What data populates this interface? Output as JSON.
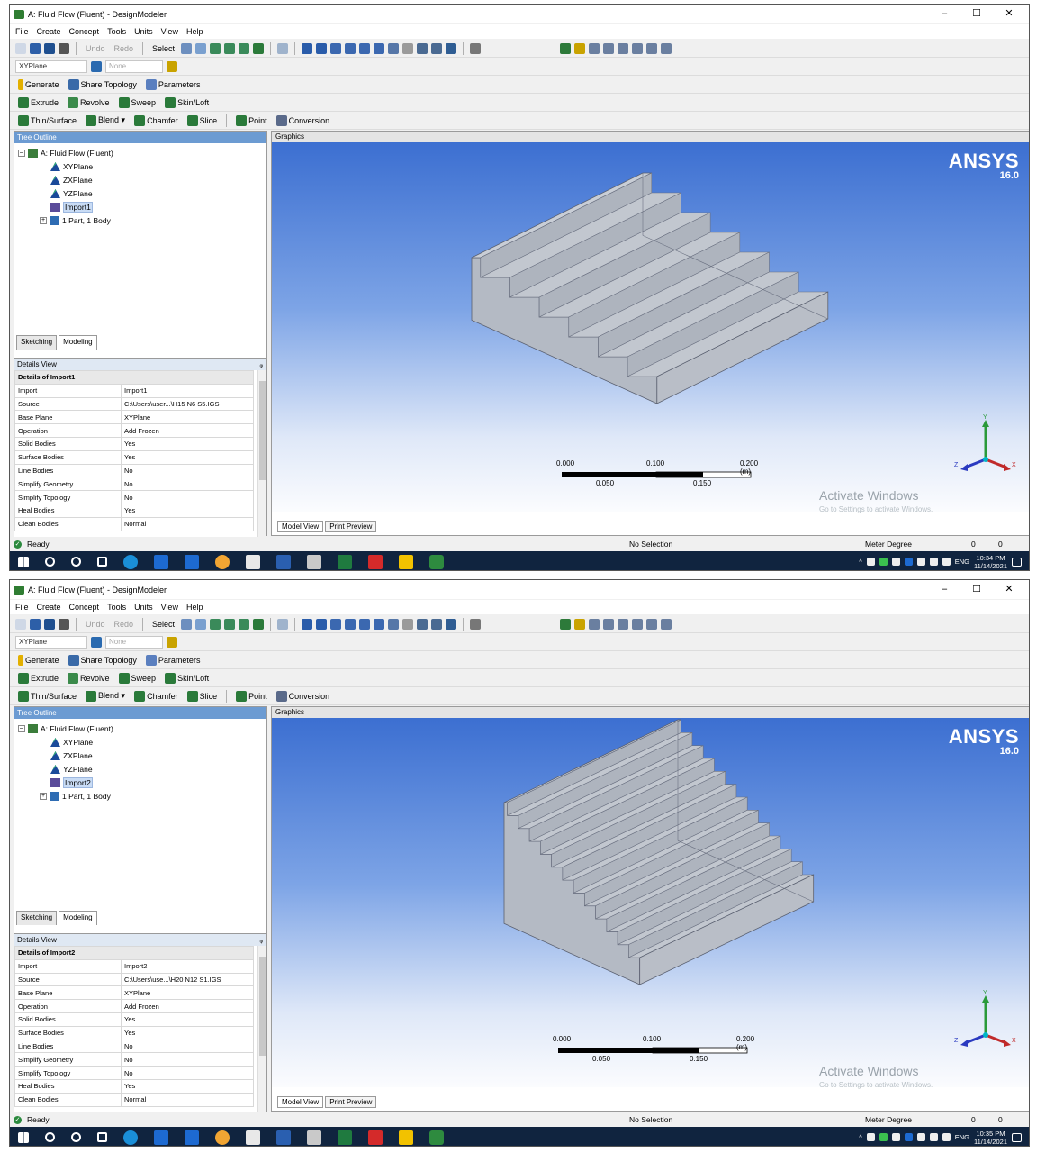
{
  "screens": [
    {
      "window_title": "A: Fluid Flow (Fluent) - DesignModeler",
      "window_controls": [
        "–",
        "☐",
        "✕"
      ],
      "menu": [
        "File",
        "Create",
        "Concept",
        "Tools",
        "Units",
        "View",
        "Help"
      ],
      "toolbar1": {
        "undo": "Undo",
        "redo": "Redo",
        "select": "Select"
      },
      "plane_combo": "XYPlane",
      "sketch_combo": "None",
      "toolbar3": [
        "Generate",
        "Share Topology",
        "Parameters"
      ],
      "toolbar4": [
        "Extrude",
        "Revolve",
        "Sweep",
        "Skin/Loft"
      ],
      "toolbar5": [
        "Thin/Surface",
        "Blend ▾",
        "Chamfer",
        "Slice",
        "Point",
        "Conversion"
      ],
      "tree_title": "Tree Outline",
      "tree": {
        "root": "A: Fluid Flow (Fluent)",
        "planes": [
          "XYPlane",
          "ZXPlane",
          "YZPlane"
        ],
        "import": "Import1",
        "body": "1 Part, 1 Body"
      },
      "tabs": [
        "Sketching",
        "Modeling"
      ],
      "details_title": "Details View",
      "details_pin": "ᵩ",
      "details_group": "Details of Import1",
      "details": [
        {
          "label": "Import",
          "value": "Import1"
        },
        {
          "label": "Source",
          "value": "C:\\Users\\user...\\H15 N6 S5.IGS"
        },
        {
          "label": "Base Plane",
          "value": "XYPlane"
        },
        {
          "label": "Operation",
          "value": "Add Frozen"
        },
        {
          "label": "Solid Bodies",
          "value": "Yes"
        },
        {
          "label": "Surface Bodies",
          "value": "Yes"
        },
        {
          "label": "Line Bodies",
          "value": "No"
        },
        {
          "label": "Simplify Geometry",
          "value": "No"
        },
        {
          "label": "Simplify Topology",
          "value": "No"
        },
        {
          "label": "Heal Bodies",
          "value": "Yes"
        },
        {
          "label": "Clean Bodies",
          "value": "Normal"
        }
      ],
      "graphics_title": "Graphics",
      "ansys_logo": "ANSYS",
      "ansys_version": "16.0",
      "scale": {
        "l0": "0.000",
        "l1": "0.050",
        "l2": "0.100",
        "l3": "0.150",
        "l4": "0.200 (m)"
      },
      "watermark": "Activate Windows",
      "watermark2": "Go to Settings to activate Windows.",
      "gtabs": [
        "Model View",
        "Print Preview"
      ],
      "status": {
        "ready": "Ready",
        "selection": "No Selection",
        "units": "Meter  Degree",
        "v1": "0",
        "v2": "0"
      },
      "clock": {
        "time": "10:34 PM",
        "date": "11/14/2021",
        "lang": "ENG"
      }
    },
    {
      "window_title": "A: Fluid Flow (Fluent) - DesignModeler",
      "window_controls": [
        "–",
        "☐",
        "✕"
      ],
      "menu": [
        "File",
        "Create",
        "Concept",
        "Tools",
        "Units",
        "View",
        "Help"
      ],
      "toolbar1": {
        "undo": "Undo",
        "redo": "Redo",
        "select": "Select"
      },
      "plane_combo": "XYPlane",
      "sketch_combo": "None",
      "toolbar3": [
        "Generate",
        "Share Topology",
        "Parameters"
      ],
      "toolbar4": [
        "Extrude",
        "Revolve",
        "Sweep",
        "Skin/Loft"
      ],
      "toolbar5": [
        "Thin/Surface",
        "Blend ▾",
        "Chamfer",
        "Slice",
        "Point",
        "Conversion"
      ],
      "tree_title": "Tree Outline",
      "tree": {
        "root": "A: Fluid Flow (Fluent)",
        "planes": [
          "XYPlane",
          "ZXPlane",
          "YZPlane"
        ],
        "import": "Import2",
        "body": "1 Part, 1 Body"
      },
      "tabs": [
        "Sketching",
        "Modeling"
      ],
      "details_title": "Details View",
      "details_pin": "ᵩ",
      "details_group": "Details of Import2",
      "details": [
        {
          "label": "Import",
          "value": "Import2"
        },
        {
          "label": "Source",
          "value": "C:\\Users\\use...\\H20 N12 S1.IGS"
        },
        {
          "label": "Base Plane",
          "value": "XYPlane"
        },
        {
          "label": "Operation",
          "value": "Add Frozen"
        },
        {
          "label": "Solid Bodies",
          "value": "Yes"
        },
        {
          "label": "Surface Bodies",
          "value": "Yes"
        },
        {
          "label": "Line Bodies",
          "value": "No"
        },
        {
          "label": "Simplify Geometry",
          "value": "No"
        },
        {
          "label": "Simplify Topology",
          "value": "No"
        },
        {
          "label": "Heal Bodies",
          "value": "Yes"
        },
        {
          "label": "Clean Bodies",
          "value": "Normal"
        }
      ],
      "graphics_title": "Graphics",
      "ansys_logo": "ANSYS",
      "ansys_version": "16.0",
      "scale": {
        "l0": "0.000",
        "l1": "0.050",
        "l2": "0.100",
        "l3": "0.150",
        "l4": "0.200 (m)"
      },
      "watermark": "Activate Windows",
      "watermark2": "Go to Settings to activate Windows.",
      "gtabs": [
        "Model View",
        "Print Preview"
      ],
      "status": {
        "ready": "Ready",
        "selection": "No Selection",
        "units": "Meter  Degree",
        "v1": "0",
        "v2": "0"
      },
      "clock": {
        "time": "10:35 PM",
        "date": "11/14/2021",
        "lang": "ENG"
      }
    }
  ],
  "colors": {
    "tree_header": "#6c9bd2",
    "viewport_top": "#3c6fd1",
    "taskbar": "#10243f",
    "model_face": "#b4bac4"
  },
  "stairs": [
    6,
    12
  ]
}
